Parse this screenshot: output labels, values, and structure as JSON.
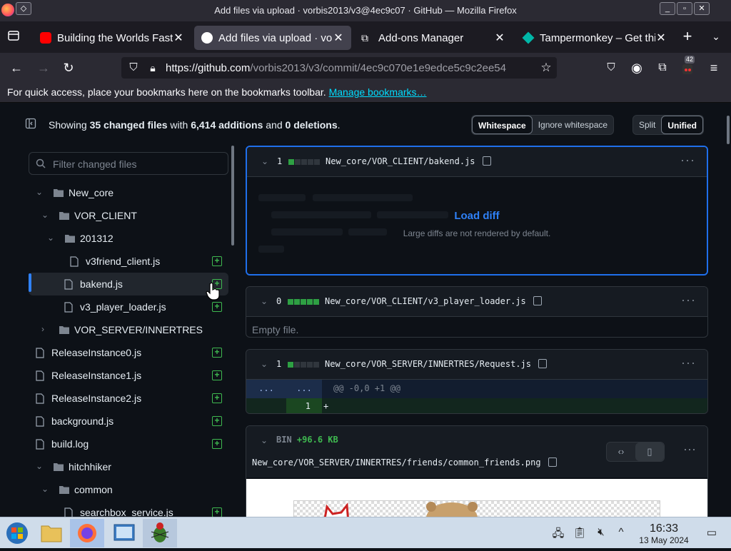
{
  "window": {
    "title": "Add files via upload · vorbis2013/v3@4ec9c07 · GitHub — Mozilla Firefox"
  },
  "tabs": [
    {
      "label": "Building the Worlds Fastest",
      "active": false
    },
    {
      "label": "Add files via upload · vorbis",
      "active": true
    },
    {
      "label": "Add-ons Manager",
      "active": false
    },
    {
      "label": "Tampermonkey – Get this",
      "active": false
    }
  ],
  "navbar": {
    "url_domain": "https://github.com",
    "url_path": "/vorbis2013/v3/commit/4ec9c070e1e9edce5c9c2ee54",
    "extension_badge": "42"
  },
  "bookmarks": {
    "text": "For quick access, place your bookmarks here on the bookmarks toolbar.",
    "link": "Manage bookmarks…"
  },
  "summary": {
    "showing": "Showing",
    "changed": "35 changed files",
    "with": "with",
    "additions": "6,414 additions",
    "and": "and",
    "deletions": "0 deletions",
    "end": "."
  },
  "toolbar": {
    "whitespace": "Whitespace",
    "ignore_whitespace": "Ignore whitespace",
    "split": "Split",
    "unified": "Unified"
  },
  "filter": {
    "placeholder": "Filter changed files"
  },
  "tree": [
    {
      "label": "New_core"
    },
    {
      "label": "VOR_CLIENT"
    },
    {
      "label": "201312"
    },
    {
      "label": "v3friend_client.js"
    },
    {
      "label": "bakend.js"
    },
    {
      "label": "v3_player_loader.js"
    },
    {
      "label": "VOR_SERVER/INNERTRES"
    },
    {
      "label": "ReleaseInstance0.js"
    },
    {
      "label": "ReleaseInstance1.js"
    },
    {
      "label": "ReleaseInstance2.js"
    },
    {
      "label": "background.js"
    },
    {
      "label": "build.log"
    },
    {
      "label": "hitchhiker"
    },
    {
      "label": "common"
    },
    {
      "label": "searchbox_service.js"
    }
  ],
  "files": [
    {
      "count": "1",
      "path": "New_core/VOR_CLIENT/bakend.js",
      "load_diff": "Load diff",
      "load_sub": "Large diffs are not rendered by default."
    },
    {
      "count": "0",
      "path": "New_core/VOR_CLIENT/v3_player_loader.js",
      "empty": "Empty file."
    },
    {
      "count": "1",
      "path": "New_core/VOR_SERVER/INNERTRES/Request.js",
      "hunk_l": "...",
      "hunk_r": "...",
      "hunk": "@@ -0,0 +1 @@",
      "line_no": "1",
      "line": "+"
    },
    {
      "bin": "BIN",
      "size": "+96.6 KB",
      "path": "New_core/VOR_SERVER/INNERTRES/friends/common_friends.png"
    }
  ],
  "taskbar": {
    "time": "16:33",
    "date": "13 May 2024"
  },
  "colors": {
    "accent": "#2f81f7",
    "addition": "#3fb950",
    "bg": "#0d1117"
  }
}
